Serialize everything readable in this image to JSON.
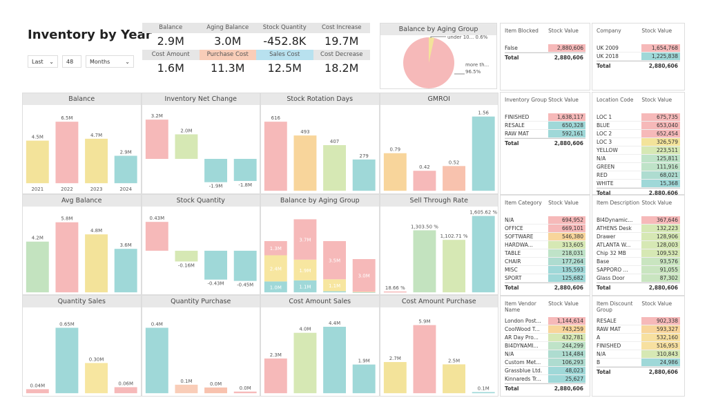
{
  "header": {
    "title": "Inventory by Year"
  },
  "filters": {
    "mode": "Last",
    "count": "48",
    "unit": "Months"
  },
  "kpis": [
    {
      "label": "Balance",
      "value": "2.9M",
      "color": "#e6e6e6"
    },
    {
      "label": "Aging Balance",
      "value": "3.0M",
      "color": "#e6e6e6"
    },
    {
      "label": "Stock Quantity",
      "value": "-452.8K",
      "color": "#e6e6e6"
    },
    {
      "label": "Cost Increase",
      "value": "19.7M",
      "color": "#e6e6e6"
    },
    {
      "label": "Cost Amount",
      "value": "1.6M",
      "color": "#e6e6e6"
    },
    {
      "label": "Purchase Cost",
      "value": "11.3M",
      "color": "#f9cdb8"
    },
    {
      "label": "Sales Cost",
      "value": "12.5M",
      "color": "#b8e1ef"
    },
    {
      "label": "Cost Decrease",
      "value": "18.2M",
      "color": "#e6e6e6"
    }
  ],
  "pie": {
    "title": "Balance by Aging Group",
    "slices": [
      {
        "label": "under 10... 0.6%",
        "value": 3.5,
        "color": "#f3e39a"
      },
      {
        "label": "more th... 96.5%",
        "value": 96.5,
        "color": "#f6b9b9"
      }
    ]
  },
  "chart_data": [
    {
      "type": "bar",
      "title": "Balance",
      "categories": [
        "2021",
        "2022",
        "2023",
        "2024"
      ],
      "values": [
        4.5,
        6.5,
        4.7,
        2.9
      ],
      "labels": [
        "4.5M",
        "6.5M",
        "4.7M",
        "2.9M"
      ],
      "colors": [
        "#f3e39a",
        "#f6b9b9",
        "#f3e39a",
        "#9fd8d8"
      ],
      "ylim": [
        0,
        7.5
      ],
      "show_x": true
    },
    {
      "type": "bar",
      "title": "Inventory Net Change",
      "categories": [
        "",
        "",
        "",
        ""
      ],
      "values": [
        3.2,
        2.0,
        -1.9,
        -1.8
      ],
      "labels": [
        "3.2M",
        "2.0M",
        "-1.9M",
        "-1.8M"
      ],
      "colors": [
        "#f6b9b9",
        "#d6e8b4",
        "#9fd8d8",
        "#9fd8d8"
      ],
      "ylim": [
        -2.6,
        3.8
      ]
    },
    {
      "type": "bar",
      "title": "Stock Rotation Days",
      "categories": [
        "",
        "",
        "",
        ""
      ],
      "values": [
        616,
        493,
        407,
        279
      ],
      "labels": [
        "616",
        "493",
        "407",
        "279"
      ],
      "colors": [
        "#f6b9b9",
        "#f8d59b",
        "#d6e8b4",
        "#9fd8d8"
      ],
      "ylim": [
        0,
        700
      ]
    },
    {
      "type": "bar",
      "title": "GMROI",
      "categories": [
        "",
        "",
        "",
        ""
      ],
      "values": [
        0.79,
        0.42,
        0.52,
        1.56
      ],
      "labels": [
        "0.79",
        "0.42",
        "0.52",
        "1.56"
      ],
      "colors": [
        "#f8d59b",
        "#f6b9b9",
        "#f8c2ae",
        "#9fd8d8"
      ],
      "ylim": [
        0,
        1.65
      ]
    },
    {
      "type": "bar",
      "title": "Avg Balance",
      "categories": [
        "",
        "",
        "",
        ""
      ],
      "values": [
        4.2,
        5.8,
        4.8,
        3.6
      ],
      "labels": [
        "4.2M",
        "5.8M",
        "4.8M",
        "3.6M"
      ],
      "colors": [
        "#c3e3bf",
        "#f6b9b9",
        "#f3e39a",
        "#9fd8d8"
      ],
      "ylim": [
        0,
        6.5
      ]
    },
    {
      "type": "bar",
      "title": "Stock Quantity",
      "categories": [
        "",
        "",
        "",
        ""
      ],
      "values": [
        0.43,
        -0.16,
        -0.43,
        -0.45
      ],
      "labels": [
        "0.43M",
        "-0.16M",
        "-0.43M",
        "-0.45M"
      ],
      "colors": [
        "#f6b9b9",
        "#d6e8b4",
        "#9fd8d8",
        "#9fd8d8"
      ],
      "ylim": [
        -0.62,
        0.55
      ]
    },
    {
      "type": "stacked-bar",
      "title": "Balance by Aging Group",
      "categories": [
        "",
        "",
        "",
        ""
      ],
      "series": [
        {
          "values": [
            1.0,
            1.1,
            0.1,
            0.0
          ],
          "labels": [
            "1.0M",
            "1.1M",
            "",
            ""
          ],
          "color": "#9fd8d8"
        },
        {
          "values": [
            2.4,
            1.9,
            1.1,
            0.05
          ],
          "labels": [
            "2.4M",
            "1.9M",
            "1.1M",
            ""
          ],
          "color": "#f7e6a0"
        },
        {
          "values": [
            1.3,
            3.7,
            3.5,
            3.0
          ],
          "labels": [
            "1.3M",
            "3.7M",
            "3.5M",
            "3.0M"
          ],
          "color": "#f6b9b9"
        }
      ],
      "ylim": [
        0,
        7.2
      ]
    },
    {
      "type": "bar",
      "title": "Sell Through Rate",
      "categories": [
        "",
        "",
        "",
        ""
      ],
      "values": [
        18.66,
        1303.5,
        1102.71,
        1605.62
      ],
      "labels": [
        "18.66 %",
        "1,303.50 %",
        "1,102.71 %",
        "1,605.62 %"
      ],
      "colors": [
        "#f6b9b9",
        "#c3e3bf",
        "#d6e8b4",
        "#9fd8d8"
      ],
      "ylim": [
        0,
        1650
      ]
    },
    {
      "type": "bar",
      "title": "Quantity Sales",
      "categories": [
        "",
        "",
        "",
        ""
      ],
      "values": [
        0.04,
        0.65,
        0.3,
        0.06
      ],
      "labels": [
        "0.04M",
        "0.65M",
        "0.30M",
        "0.06M"
      ],
      "colors": [
        "#f6b9b9",
        "#9fd8d8",
        "#f7e6a0",
        "#f6b9b9"
      ],
      "ylim": [
        0,
        0.78
      ]
    },
    {
      "type": "bar",
      "title": "Quantity Purchase",
      "categories": [
        "",
        "",
        "",
        ""
      ],
      "values": [
        0.4,
        0.052,
        0.035,
        0.01
      ],
      "labels": [
        "0.4M",
        "0.1M",
        "0.0M",
        "0.0M"
      ],
      "colors": [
        "#9fd8d8",
        "#f9cdb8",
        "#f8c2ae",
        "#f6b9b9"
      ],
      "ylim": [
        0,
        0.48
      ]
    },
    {
      "type": "bar",
      "title": "Cost Amount Sales",
      "categories": [
        "",
        "",
        "",
        ""
      ],
      "values": [
        2.3,
        4.0,
        4.4,
        1.9
      ],
      "labels": [
        "2.3M",
        "4.0M",
        "4.4M",
        "1.9M"
      ],
      "colors": [
        "#f6b9b9",
        "#d6e8b4",
        "#9fd8d8",
        "#9fd8d8"
      ],
      "ylim": [
        0,
        5.2
      ]
    },
    {
      "type": "bar",
      "title": "Cost Amount Purchase",
      "categories": [
        "",
        "",
        "",
        ""
      ],
      "values": [
        2.7,
        5.9,
        2.5,
        0.1
      ],
      "labels": [
        "2.7M",
        "5.9M",
        "2.5M",
        "0.1M"
      ],
      "colors": [
        "#f3e39a",
        "#f6b9b9",
        "#f3e39a",
        "#9fd8d8"
      ],
      "ylim": [
        0,
        6.8
      ]
    }
  ],
  "tables": [
    {
      "h1": "Item Blocked",
      "h2": "Stock Value",
      "rows": [
        [
          "False",
          "2,880,606",
          "#f6b9b9"
        ]
      ],
      "total": "2,880,606"
    },
    {
      "h1": "Company",
      "h2": "Stock Value",
      "rows": [
        [
          "UK 2009",
          "1,654,768",
          "#f6b9b9"
        ],
        [
          "UK 2018",
          "1,225,838",
          "#9fd8d8"
        ]
      ],
      "total": "2,880,606"
    },
    {
      "h1": "Inventory Group",
      "h2": "Stock Value",
      "rows": [
        [
          "FINISHED",
          "1,638,117",
          "#f6b9b9"
        ],
        [
          "RESALE",
          "650,328",
          "#9fd8d8"
        ],
        [
          "RAW MAT",
          "592,161",
          "#9fd8d8"
        ]
      ],
      "total": "2,880,606"
    },
    {
      "h1": "Location Code",
      "h2": "Stock Value",
      "rows": [
        [
          "LOC 1",
          "675,735",
          "#f6b9b9"
        ],
        [
          "BLUE",
          "653,040",
          "#f6b9b9"
        ],
        [
          "LOC 2",
          "652,454",
          "#f6b9b9"
        ],
        [
          "LOC 3",
          "326,579",
          "#f3e39a"
        ],
        [
          "YELLOW",
          "223,511",
          "#d6e8b4"
        ],
        [
          "N/A",
          "125,811",
          "#bfe3c8"
        ],
        [
          "GREEN",
          "111,916",
          "#bfe3c8"
        ],
        [
          "RED",
          "68,021",
          "#aedcd0"
        ],
        [
          "WHITE",
          "15,368",
          "#9fd8d8"
        ]
      ],
      "total": "2,880,606"
    },
    {
      "h1": "Item Category",
      "h2": "Stock Value",
      "rows": [
        [
          "N/A",
          "694,952",
          "#f6b9b9"
        ],
        [
          "OFFICE",
          "669,101",
          "#f6b9b9"
        ],
        [
          "SOFTWARE",
          "546,380",
          "#f8d59b"
        ],
        [
          "HARDWA...",
          "313,605",
          "#d6e8b4"
        ],
        [
          "TABLE",
          "218,031",
          "#bfe3c8"
        ],
        [
          "CHAIR",
          "177,264",
          "#aedcd0"
        ],
        [
          "MISC",
          "135,593",
          "#9fd8d8"
        ],
        [
          "SPORT",
          "125,682",
          "#9fd8d8"
        ]
      ],
      "total": "2,880,606"
    },
    {
      "h1": "Item Description",
      "h2": "Stock Value",
      "rows": [
        [
          "BI4Dynamic...",
          "367,646",
          "#f6b9b9"
        ],
        [
          "ATHENS Desk",
          "132,223",
          "#d6e8b4"
        ],
        [
          "Drawer",
          "128,906",
          "#d6e8b4"
        ],
        [
          "ATLANTA W...",
          "128,003",
          "#d6e8b4"
        ],
        [
          "Chip 32 MB",
          "109,532",
          "#d6e8b4"
        ],
        [
          "Base",
          "93,576",
          "#c9e5c0"
        ],
        [
          "SAPPORO ...",
          "91,055",
          "#c9e5c0"
        ],
        [
          "Glass Door",
          "87,302",
          "#c9e5c0"
        ]
      ],
      "total": "2,880,606"
    },
    {
      "h1": "Item Vendor Name",
      "h2": "Stock Value",
      "rows": [
        [
          "London Post...",
          "1,144,614",
          "#f6b9b9"
        ],
        [
          "CoolWood T...",
          "743,259",
          "#f8d59b"
        ],
        [
          "AR Day Pro...",
          "432,781",
          "#d6e8b4"
        ],
        [
          "BI4DYNAMI...",
          "244,299",
          "#bfe3c8"
        ],
        [
          "N/A",
          "114,484",
          "#aedcd0"
        ],
        [
          "Custom Met...",
          "106,293",
          "#aedcd0"
        ],
        [
          "Grassblue Ltd.",
          "48,023",
          "#9fd8d8"
        ],
        [
          "Kinnareds Tr...",
          "25,627",
          "#9fd8d8"
        ]
      ],
      "total": "2,880,606"
    },
    {
      "h1": "Item Discount Group",
      "h2": "Stock Value",
      "rows": [
        [
          "RESALE",
          "902,338",
          "#f6b9b9"
        ],
        [
          "RAW MAT",
          "593,327",
          "#f8d59b"
        ],
        [
          "A",
          "532,160",
          "#f7e0a0"
        ],
        [
          "FINISHED",
          "516,953",
          "#f7e0a0"
        ],
        [
          "N/A",
          "310,843",
          "#d6e8b4"
        ],
        [
          "B",
          "24,986",
          "#9fd8d8"
        ]
      ],
      "total": "2,880,606"
    }
  ]
}
